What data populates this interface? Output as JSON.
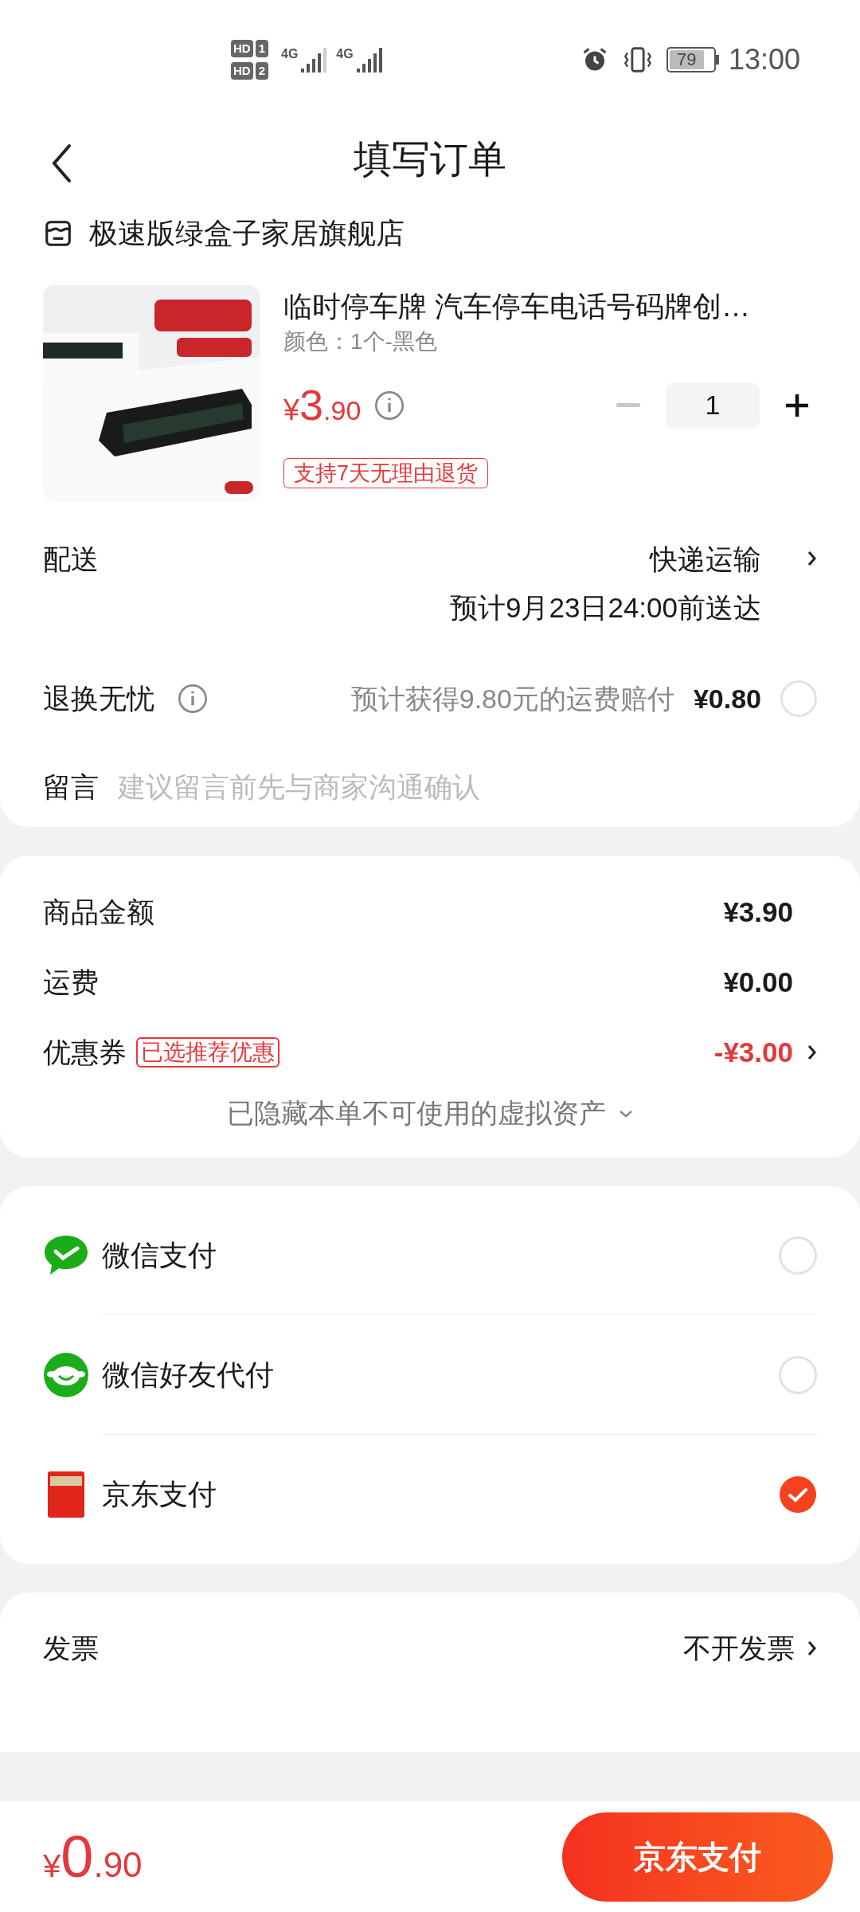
{
  "status_bar": {
    "sims": [
      {
        "badge": "HD",
        "slot": "1"
      },
      {
        "badge": "HD",
        "slot": "2"
      }
    ],
    "networks": [
      "4G",
      "4G"
    ],
    "battery": "79",
    "time": "13:00"
  },
  "header": {
    "title": "填写订单"
  },
  "store": {
    "name": "极速版绿盒子家居旗舰店"
  },
  "product": {
    "kind": "picture",
    "title": "临时停车牌 汽车停车电话号码牌创…",
    "variant": "颜色：1个-黑色",
    "price": {
      "symbol": "¥",
      "integer": "3",
      "decimal": ".90"
    },
    "quantity": "1",
    "minus_disabled": true,
    "badge": "支持7天无理由退货"
  },
  "delivery": {
    "label": "配送",
    "method": "快递运输",
    "eta": "预计9月23日24:00前送达"
  },
  "return_insurance": {
    "label": "退换无忧",
    "note": "预计获得9.80元的运费赔付",
    "price": "¥0.80",
    "checked": false
  },
  "message": {
    "label": "留言",
    "placeholder": "建议留言前先与商家沟通确认"
  },
  "summary": {
    "rows": [
      {
        "kind": "plain",
        "label": "商品金额",
        "value": "¥3.90"
      },
      {
        "kind": "plain",
        "label": "运费",
        "value": "¥0.00"
      },
      {
        "kind": "coupon",
        "label": "优惠券",
        "tag": "已选推荐优惠",
        "value": "-¥3.00"
      }
    ],
    "hidden_note": "已隐藏本单不可使用的虚拟资产"
  },
  "payment_methods": [
    {
      "kind": "wechat",
      "name": "微信支付",
      "selected": false
    },
    {
      "kind": "wechat_friend",
      "name": "微信好友代付",
      "selected": false
    },
    {
      "kind": "jd",
      "name": "京东支付",
      "selected": true
    }
  ],
  "invoice": {
    "label": "发票",
    "value": "不开发票"
  },
  "footer": {
    "total": {
      "symbol": "¥",
      "integer": "0",
      "decimal": ".90"
    },
    "button": "京东支付"
  }
}
